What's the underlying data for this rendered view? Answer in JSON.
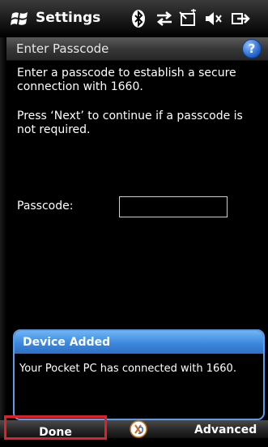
{
  "status": {
    "app_title": "Settings",
    "icons": [
      "windows-logo",
      "bluetooth-icon",
      "sync-arrows-icon",
      "no-signal-icon",
      "speaker-mute-icon",
      "exit-icon"
    ]
  },
  "header": {
    "title": "Enter Passcode",
    "help": "?"
  },
  "main": {
    "instruction1": "Enter a passcode to establish a secure connection with 1660.",
    "instruction2": "Press ‘Next’ to continue if a passcode is not required.",
    "passcode_label": "Passcode:",
    "passcode_value": ""
  },
  "notification": {
    "title": "Device Added",
    "message": "Your Pocket PC has connected with 1660."
  },
  "menu": {
    "left": "Done",
    "right": "Advanced"
  },
  "colors": {
    "notification_header": "#3d88dc",
    "highlight_border": "#e0202a"
  }
}
